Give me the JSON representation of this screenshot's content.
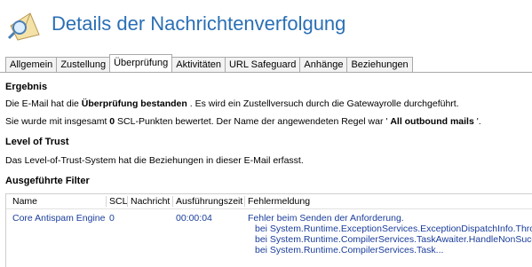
{
  "header": {
    "title": "Details der Nachrichtenverfolgung",
    "icon": "envelope-search-icon"
  },
  "tabs": [
    {
      "label": "Allgemein",
      "active": false
    },
    {
      "label": "Zustellung",
      "active": false
    },
    {
      "label": "Überprüfung",
      "active": true
    },
    {
      "label": "Aktivitäten",
      "active": false
    },
    {
      "label": "URL Safeguard",
      "active": false
    },
    {
      "label": "Anhänge",
      "active": false
    },
    {
      "label": "Beziehungen",
      "active": false
    }
  ],
  "result": {
    "heading": "Ergebnis",
    "line1_pre": "Die E-Mail hat die ",
    "line1_bold": "Überprüfung bestanden",
    "line1_post": " . Es wird ein Zustellversuch durch die Gatewayrolle durchgeführt.",
    "line2_pre": "Sie wurde mit insgesamt ",
    "line2_bold1": "0",
    "line2_mid": " SCL-Punkten bewertet.  Der Name der angewendeten Regel war ' ",
    "line2_bold2": "All outbound mails",
    "line2_post": " '."
  },
  "trust": {
    "heading": "Level of Trust",
    "text": "Das Level-of-Trust-System hat die Beziehungen in dieser E-Mail erfasst."
  },
  "filters": {
    "heading": "Ausgeführte Filter",
    "columns": [
      "Name",
      "SCL",
      "Nachricht",
      "Ausführungszeit",
      "Fehlermeldung"
    ],
    "rows": [
      {
        "name": "Core Antispam Engine",
        "scl": "0",
        "nachricht": "",
        "zeit": "00:00:04",
        "fehler": [
          "Fehler beim Senden der Anforderung.",
          "bei System.Runtime.ExceptionServices.ExceptionDispatchInfo.Throw",
          "bei System.Runtime.CompilerServices.TaskAwaiter.HandleNonSucce",
          "bei System.Runtime.CompilerServices.Task..."
        ]
      }
    ]
  },
  "colors": {
    "title": "#2a6fb5",
    "link": "#1a3d9c"
  }
}
